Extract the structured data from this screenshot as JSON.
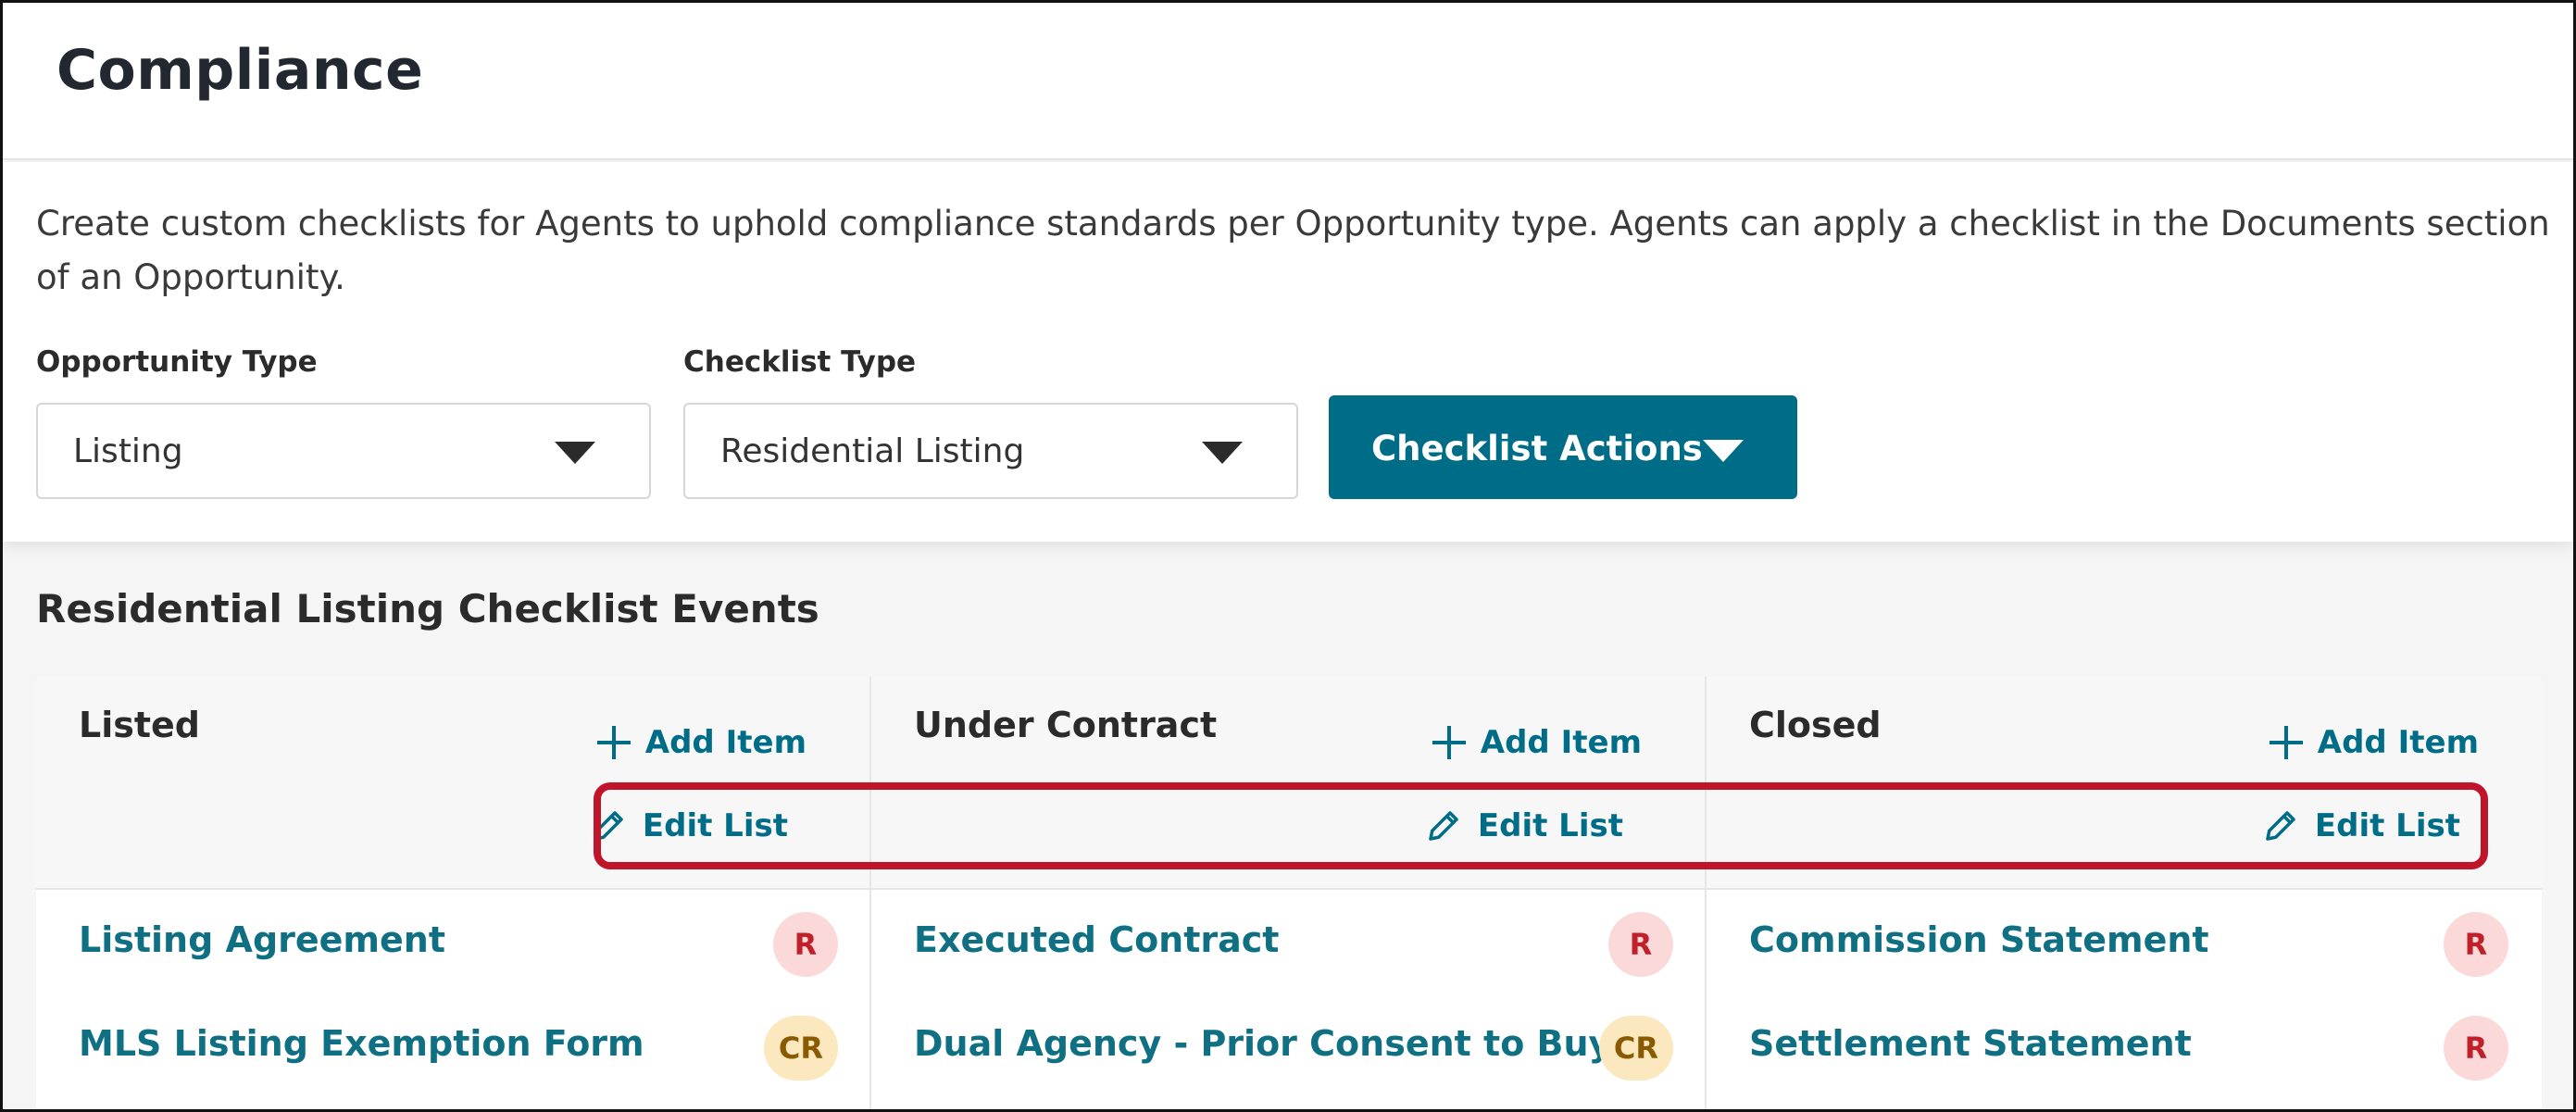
{
  "header": {
    "title": "Compliance"
  },
  "settings": {
    "description": "Create custom checklists for Agents to uphold compliance standards per Opportunity type. Agents can apply a checklist in the Documents section of an Opportunity.",
    "opportunity_type": {
      "label": "Opportunity Type",
      "value": "Listing"
    },
    "checklist_type": {
      "label": "Checklist Type",
      "value": "Residential Listing"
    },
    "actions_button": "Checklist Actions"
  },
  "events": {
    "title": "Residential Listing Checklist Events",
    "add_item_label": "Add Item",
    "edit_list_label": "Edit List",
    "columns": [
      {
        "title": "Listed",
        "items": [
          {
            "name": "Listing Agreement",
            "badge": "R"
          },
          {
            "name": "MLS Listing Exemption Form",
            "badge": "CR"
          }
        ]
      },
      {
        "title": "Under Contract",
        "items": [
          {
            "name": "Executed Contract",
            "badge": "R"
          },
          {
            "name": "Dual Agency - Prior Consent to Buyer",
            "badge": "CR"
          }
        ]
      },
      {
        "title": "Closed",
        "items": [
          {
            "name": "Commission Statement",
            "badge": "R"
          },
          {
            "name": "Settlement Statement",
            "badge": "R"
          }
        ]
      }
    ]
  },
  "colors": {
    "accent": "#006d88",
    "link": "#0f7083",
    "highlight": "#c0142b",
    "badge_required_bg": "#fbd9d9",
    "badge_conditional_bg": "#fbe8be"
  },
  "icons": [
    "plus-icon",
    "pencil-icon",
    "chevron-down-icon"
  ]
}
